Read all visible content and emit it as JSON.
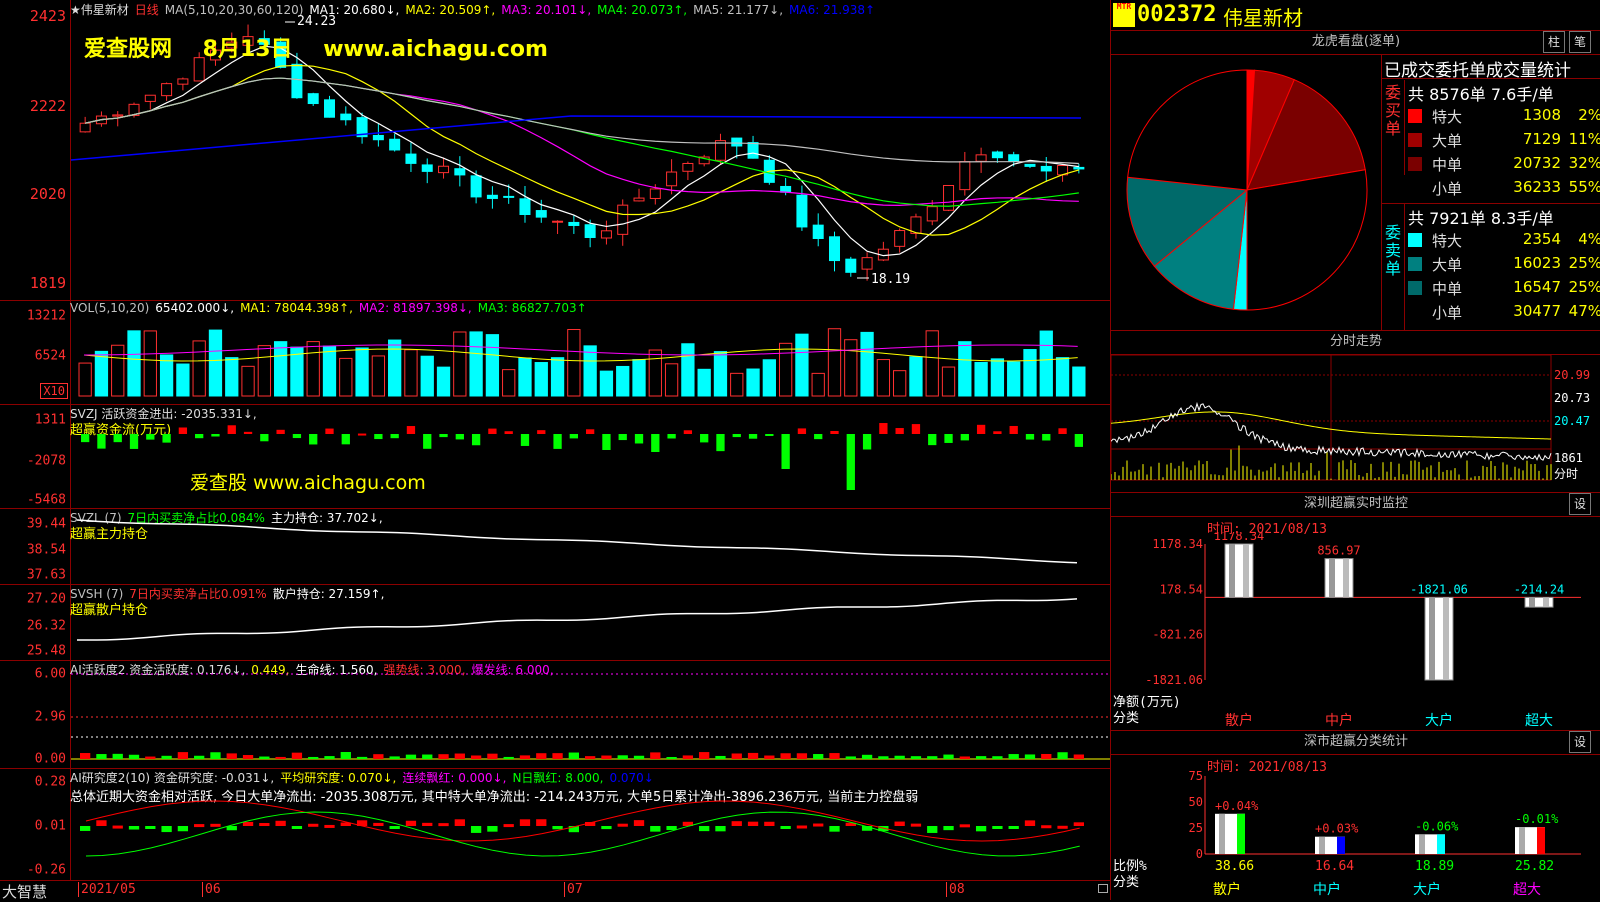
{
  "stock": {
    "code": "002372",
    "name": "伟星新材",
    "period": "日线",
    "badge": "MTR"
  },
  "watermark": {
    "top": "爱查股网    8月13日    www.aichagu.com",
    "mid": "爱查股 www.aichagu.com"
  },
  "price_panel": {
    "header": [
      {
        "text": "★伟星新材",
        "color": "#dddddd"
      },
      {
        "text": "日线",
        "color": "#ff3030"
      },
      {
        "text": "MA(5,10,20,30,60,120)",
        "color": "#c0c0c0"
      },
      {
        "text": "MA1: 20.680↓,",
        "color": "#ffffff"
      },
      {
        "text": "MA2: 20.509↑,",
        "color": "#ffff00"
      },
      {
        "text": "MA3: 20.101↓,",
        "color": "#ff00ff"
      },
      {
        "text": "MA4: 20.073↑,",
        "color": "#00ff00"
      },
      {
        "text": "MA5: 21.177↓,",
        "color": "#c0c0c0"
      },
      {
        "text": "MA6: 21.938↑",
        "color": "#0000ff"
      }
    ],
    "yticks": [
      "2423",
      "2222",
      "2020",
      "1819"
    ],
    "high_label": "24.23",
    "low_label": "18.19"
  },
  "vol_panel": {
    "header": [
      {
        "text": "VOL(5,10,20)",
        "color": "#c0c0c0"
      },
      {
        "text": "65402.000↓,",
        "color": "#ffffff"
      },
      {
        "text": "MA1: 78044.398↑,",
        "color": "#ffff00"
      },
      {
        "text": "MA2: 81897.398↓,",
        "color": "#ff00ff"
      },
      {
        "text": "MA3: 86827.703↑",
        "color": "#00ff00"
      }
    ],
    "yticks": [
      "13212",
      "6524"
    ],
    "unit": "X10"
  },
  "svzj_panel": {
    "header": [
      {
        "text": "SVZJ  活跃资金进出: -2035.331↓,",
        "color": "#dddddd"
      }
    ],
    "sub": "超赢资金流(万元)",
    "yticks": [
      "1311",
      "-2078",
      "-5468"
    ]
  },
  "svzl_panel": {
    "header": [
      {
        "text": "SVZL (7)",
        "color": "#c0c0c0"
      },
      {
        "text": "7日内买卖净占比0.084%",
        "color": "#00ff00"
      },
      {
        "text": "主力持仓: 37.702↓,",
        "color": "#ffffff"
      }
    ],
    "sub": "超赢主力持仓",
    "yticks": [
      "39.44",
      "38.54",
      "37.63"
    ]
  },
  "svsh_panel": {
    "header": [
      {
        "text": "SVSH (7)",
        "color": "#c0c0c0"
      },
      {
        "text": "7日内买卖净占比0.091%",
        "color": "#ff3030"
      },
      {
        "text": "散户持仓: 27.159↑,",
        "color": "#ffffff"
      }
    ],
    "sub": "超赢散户持仓",
    "yticks": [
      "27.20",
      "26.32",
      "25.48"
    ]
  },
  "ai_active_panel": {
    "header": [
      {
        "text": "AI活跃度2 资金活跃度: 0.176↓,",
        "color": "#dddddd"
      },
      {
        "text": "0.449,",
        "color": "#ffff00"
      },
      {
        "text": "生命线: 1.560,",
        "color": "#ffffff"
      },
      {
        "text": "强势线: 3.000,",
        "color": "#ff3030"
      },
      {
        "text": "爆发线: 6.000,",
        "color": "#ff00ff"
      }
    ],
    "yticks": [
      "6.00",
      "2.96",
      "0.00"
    ]
  },
  "ai_research_panel": {
    "header": [
      {
        "text": "AI研究度2(10) 资金研究度: -0.031↓,",
        "color": "#dddddd"
      },
      {
        "text": "平均研究度: 0.070↓,",
        "color": "#ffff00"
      },
      {
        "text": "连续飘红: 0.000↓,",
        "color": "#ff00ff"
      },
      {
        "text": "N日飘红: 8.000,",
        "color": "#00ff00"
      },
      {
        "text": "0.070↓",
        "color": "#0000ff"
      }
    ],
    "summary": "总体近期大资金相对活跃, 今日大单净流出: -2035.308万元, 其中特大单净流出: -214.243万元, 大单5日累计净出-3896.236万元, 当前主力控盘弱",
    "yticks": [
      "0.28",
      "0.01",
      "-0.26"
    ]
  },
  "x_axis": {
    "brand": "大智慧",
    "labels": [
      "2021/05",
      "06",
      "07",
      "08"
    ]
  },
  "dragon_tiger": {
    "title": "龙虎看盘(逐单)",
    "btn1": "柱",
    "btn2": "笔",
    "table_title": "已成交委托单成交量统计",
    "buy_side_label": "委买单",
    "buy_summary": "共 8576单 7.6手/单",
    "buy_rows": [
      {
        "label": "特大",
        "value": "1308",
        "pct": "2%",
        "color": "#ff0000"
      },
      {
        "label": "大单",
        "value": "7129",
        "pct": "11%",
        "color": "#a00000"
      },
      {
        "label": "中单",
        "value": "20732",
        "pct": "32%",
        "color": "#7a0000"
      },
      {
        "label": "小单",
        "value": "36233",
        "pct": "55%",
        "color": "#000000"
      }
    ],
    "sell_side_label": "委卖单",
    "sell_summary": "共 7921单 8.3手/单",
    "sell_rows": [
      {
        "label": "特大",
        "value": "2354",
        "pct": "4%",
        "color": "#00ffff"
      },
      {
        "label": "大单",
        "value": "16023",
        "pct": "25%",
        "color": "#008080"
      },
      {
        "label": "中单",
        "value": "16547",
        "pct": "25%",
        "color": "#006a6a"
      },
      {
        "label": "小单",
        "value": "30477",
        "pct": "47%",
        "color": "#000000"
      }
    ]
  },
  "intraday": {
    "title": "分时走势",
    "right_labels": [
      "20.99",
      "20.73",
      "20.47",
      "1861",
      "分时"
    ]
  },
  "sz_monitor": {
    "title": "深圳超赢实时监控",
    "btn": "设",
    "time": "时间: 2021/08/13",
    "yticks": [
      "1178.34",
      "178.54",
      "-821.26",
      "-1821.06"
    ],
    "unit_label": "净额(万元)",
    "cat_label": "分类",
    "bars": [
      {
        "label": "散户",
        "value": 1178.34,
        "text": "1178.34",
        "label_color": "#ff3030"
      },
      {
        "label": "中户",
        "value": 856.97,
        "text": "856.97",
        "label_color": "#ff3030"
      },
      {
        "label": "大户",
        "value": -1821.06,
        "text": "-1821.06",
        "label_color": "#00ffff"
      },
      {
        "label": "超大",
        "value": -214.24,
        "text": "-214.24",
        "label_color": "#00ffff"
      }
    ]
  },
  "sz_category": {
    "title": "深市超赢分类统计",
    "btn": "设",
    "time": "时间: 2021/08/13",
    "yticks": [
      "75",
      "50",
      "25",
      "0"
    ],
    "ratio_label": "比例%",
    "cat_label": "分类",
    "bars": [
      {
        "label": "散户",
        "value": 38.66,
        "text": "38.66",
        "delta": "+0.04%",
        "color": "#00ff00",
        "label_color": "#ffff00"
      },
      {
        "label": "中户",
        "value": 16.64,
        "text": "16.64",
        "delta": "+0.03%",
        "color": "#0000ff",
        "label_color": "#ff3030"
      },
      {
        "label": "大户",
        "value": 18.89,
        "text": "18.89",
        "delta": "-0.06%",
        "color": "#00ffff",
        "label_color": "#00ff00"
      },
      {
        "label": "超大",
        "value": 25.82,
        "text": "25.82",
        "delta": "-0.01%",
        "color": "#ff0000",
        "label_color": "#00ff00"
      }
    ]
  }
}
